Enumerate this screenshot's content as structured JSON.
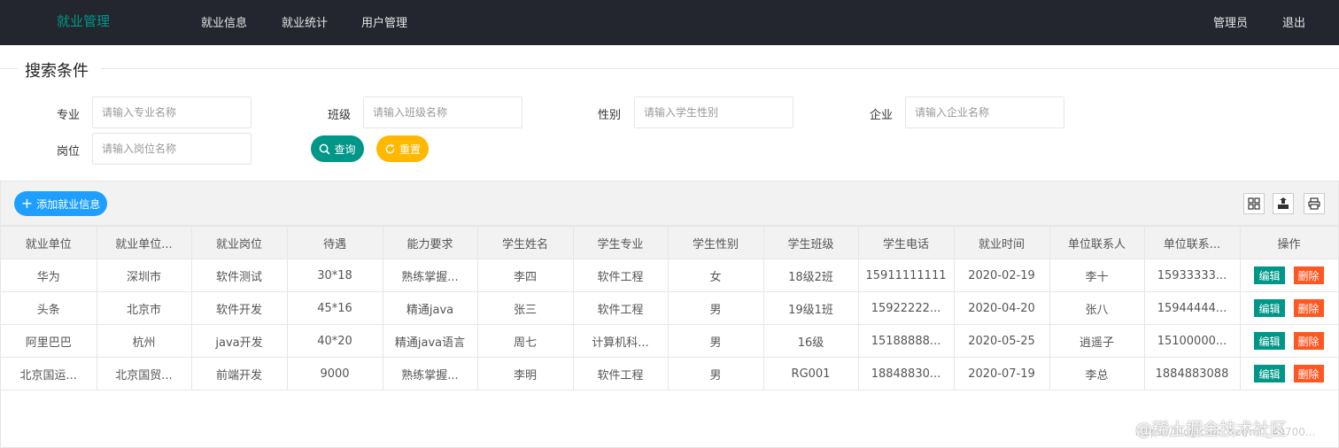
{
  "header": {
    "logo": "就业管理",
    "nav": [
      "就业信息",
      "就业统计",
      "用户管理"
    ],
    "admin": "管理员",
    "logout": "退出"
  },
  "search": {
    "legend": "搜索条件",
    "fields": [
      {
        "label": "专业",
        "placeholder": "请输入专业名称"
      },
      {
        "label": "班级",
        "placeholder": "请输入班级名称"
      },
      {
        "label": "性别",
        "placeholder": "请输入学生性别"
      },
      {
        "label": "企业",
        "placeholder": "请输入企业名称"
      },
      {
        "label": "岗位",
        "placeholder": "请输入岗位名称"
      }
    ],
    "query_label": "查询",
    "reset_label": "重置"
  },
  "toolbar": {
    "add_label": "添加就业信息"
  },
  "table": {
    "columns": [
      "就业单位",
      "就业单位...",
      "就业岗位",
      "待遇",
      "能力要求",
      "学生姓名",
      "学生专业",
      "学生性别",
      "学生班级",
      "学生电话",
      "就业时间",
      "单位联系人",
      "单位联系...",
      "操作"
    ],
    "rows": [
      [
        "华为",
        "深圳市",
        "软件测试",
        "30*18",
        "熟练掌握...",
        "李四",
        "软件工程",
        "女",
        "18级2班",
        "15911111111",
        "2020-02-19",
        "李十",
        "15933333..."
      ],
      [
        "头条",
        "北京市",
        "软件开发",
        "45*16",
        "精通java",
        "张三",
        "软件工程",
        "男",
        "19级1班",
        "15922222...",
        "2020-04-20",
        "张八",
        "15944444..."
      ],
      [
        "阿里巴巴",
        "杭州",
        "java开发",
        "40*20",
        "精通java语言",
        "周七",
        "计算机科...",
        "男",
        "16级",
        "15188888...",
        "2020-05-25",
        "逍遥子",
        "15100000..."
      ],
      [
        "北京国运...",
        "北京国贸...",
        "前端开发",
        "9000",
        "熟练掌握...",
        "李明",
        "软件工程",
        "男",
        "RG001",
        "18848830...",
        "2020-07-19",
        "李总",
        "1884883088"
      ]
    ],
    "edit_label": "编辑",
    "delete_label": "删除"
  },
  "watermark": {
    "text": "@稀土掘金技术社区",
    "url": "https://blog.csdn.net/m0_49700..."
  },
  "colors": {
    "header_bg": "#23262e",
    "primary": "#009688",
    "warm": "#ffb800",
    "normal": "#1e9fff",
    "danger": "#ff5722"
  }
}
